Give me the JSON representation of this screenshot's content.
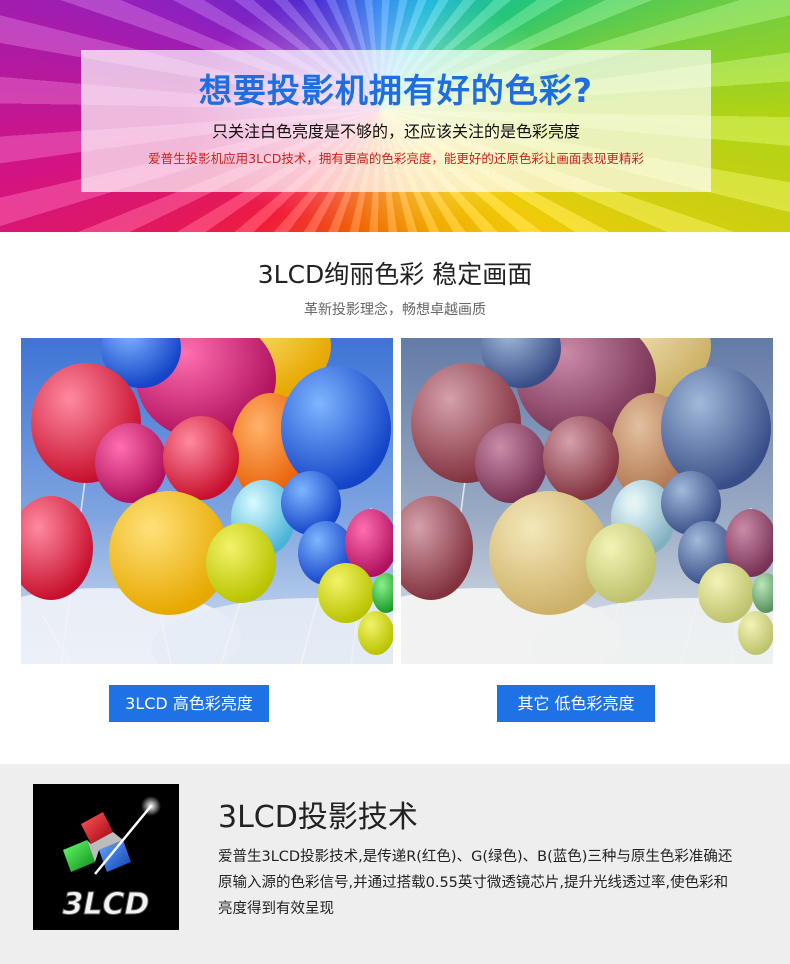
{
  "hero": {
    "title": "想要投影机拥有好的色彩?",
    "subtitle": "只关注白色亮度是不够的，还应该关注的是色彩亮度",
    "description": "爱普生投影机应用3LCD技术，拥有更高的色彩亮度，能更好的还原色彩让画面表现更精彩"
  },
  "section": {
    "title": "3LCD绚丽色彩 稳定画面",
    "subtitle": "革新投影理念，畅想卓越画质"
  },
  "comparison": {
    "left_label": "3LCD  高色彩亮度",
    "right_label": "其它  低色彩亮度"
  },
  "tech": {
    "logo_text": "3LCD",
    "title": "3LCD投影技术",
    "description": "爱普生3LCD投影技术,是传递R(红色)、G(绿色)、B(蓝色)三种与原生色彩准确还原输入源的色彩信号,并通过搭载0.55英寸微透镜芯片,提升光线透过率,使色彩和亮度得到有效呈现"
  },
  "colors": {
    "accent_blue": "#1e72e6",
    "title_blue": "#1f6ee0",
    "desc_red": "#c8231e"
  }
}
